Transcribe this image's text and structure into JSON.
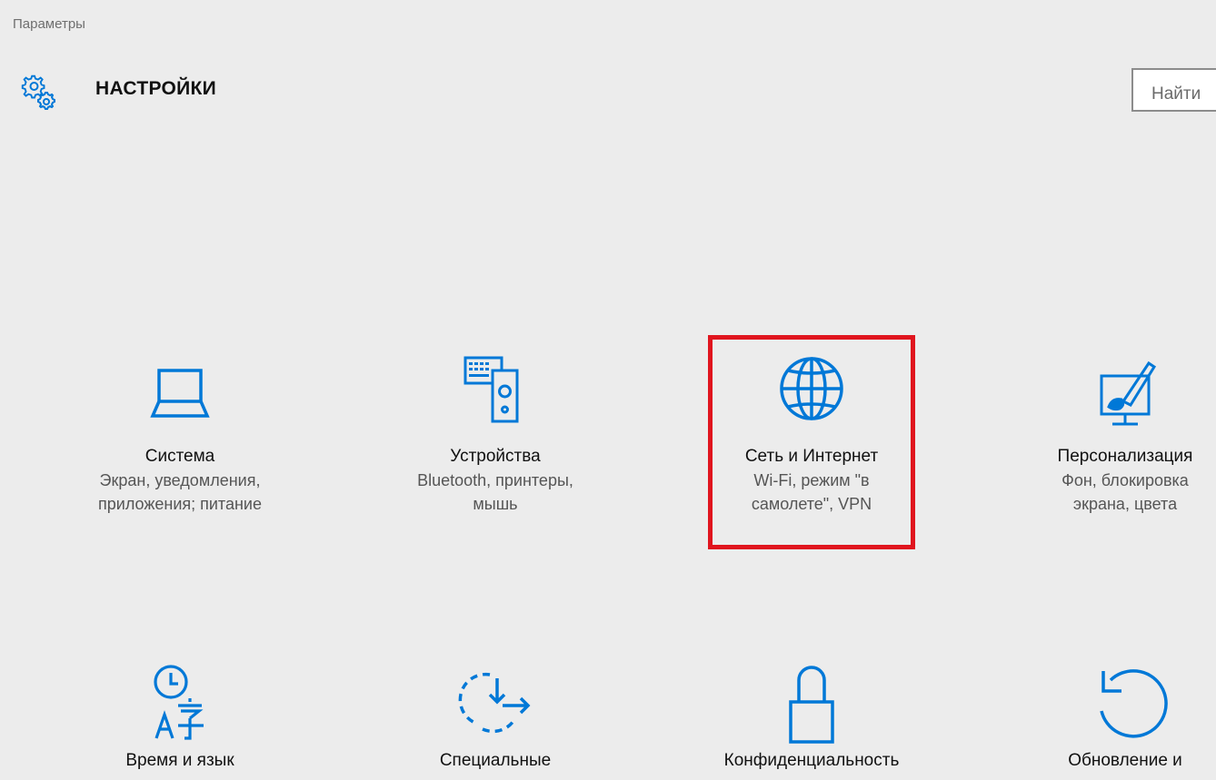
{
  "window": {
    "title": "Параметры"
  },
  "header": {
    "title": "НАСТРОЙКИ",
    "search_placeholder": "Найти"
  },
  "colors": {
    "accent": "#0078d7",
    "highlight": "#e0151e"
  },
  "tiles": [
    {
      "name": "Система",
      "desc": "Экран, уведомления,\nприложения; питание",
      "icon": "laptop-icon"
    },
    {
      "name": "Устройства",
      "desc": "Bluetooth, принтеры,\nмышь",
      "icon": "devices-icon"
    },
    {
      "name": "Сеть и Интернет",
      "desc": "Wi-Fi, режим \"в\nсамолете\", VPN",
      "icon": "globe-icon"
    },
    {
      "name": "Персонализация",
      "desc": "Фон, блокировка\nэкрана, цвета",
      "icon": "personalization-icon"
    },
    {
      "name": "Время и язык",
      "desc": "",
      "icon": "time-language-icon"
    },
    {
      "name": "Специальные",
      "desc": "",
      "icon": "ease-of-access-icon"
    },
    {
      "name": "Конфиденциальность",
      "desc": "",
      "icon": "lock-icon"
    },
    {
      "name": "Обновление и",
      "desc": "",
      "icon": "update-icon"
    }
  ]
}
